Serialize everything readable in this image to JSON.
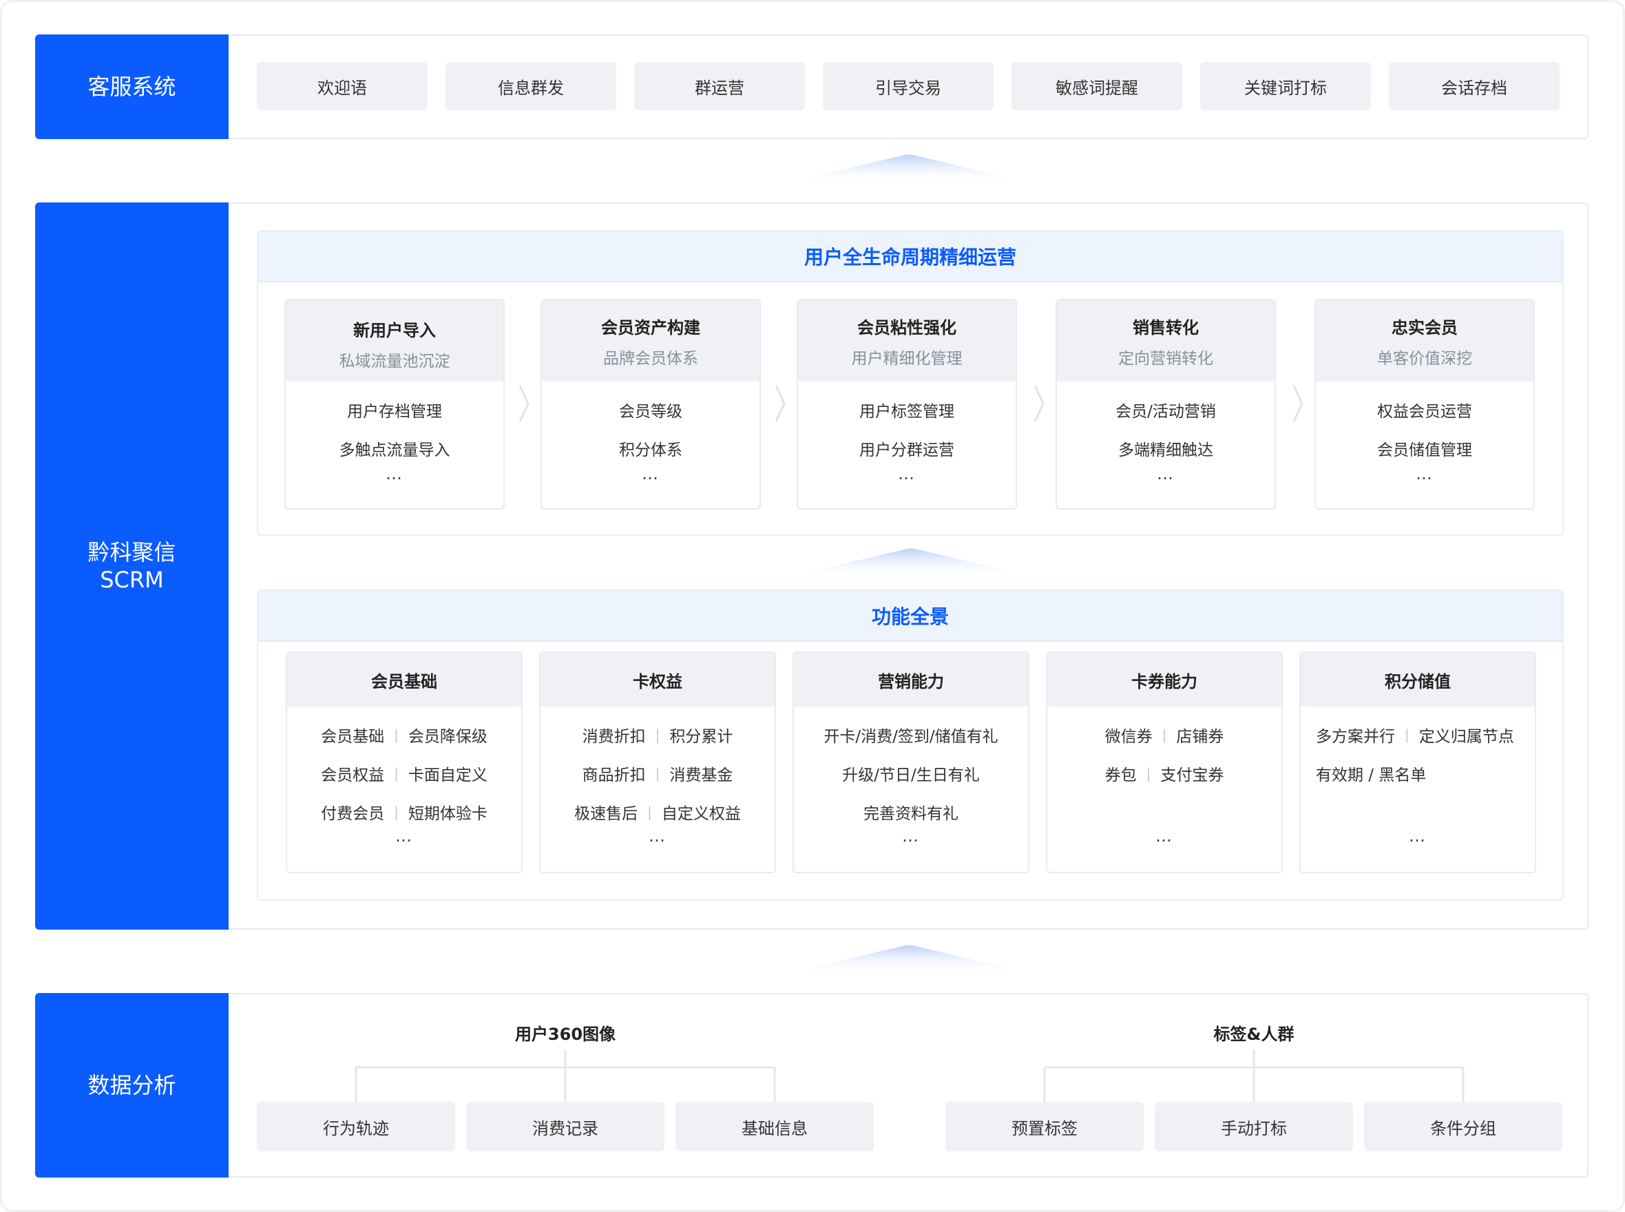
{
  "top": {
    "side_label": "客服系统",
    "chips": [
      "欢迎语",
      "信息群发",
      "群运营",
      "引导交易",
      "敏感词提醒",
      "关键词打标",
      "会话存档"
    ]
  },
  "middle": {
    "side_line1": "黔科聚信",
    "side_line2": "SCRM",
    "lifecycle": {
      "title": "用户全生命周期精细运营",
      "stages": [
        {
          "title": "新用户导入",
          "subtitle": "私域流量池沉淀",
          "items": [
            "用户存档管理",
            "多触点流量导入"
          ],
          "more": "…"
        },
        {
          "title": "会员资产构建",
          "subtitle": "品牌会员体系",
          "items": [
            "会员等级",
            "积分体系"
          ],
          "more": "…"
        },
        {
          "title": "会员粘性强化",
          "subtitle": "用户精细化管理",
          "items": [
            "用户标签管理",
            "用户分群运营"
          ],
          "more": "…"
        },
        {
          "title": "销售转化",
          "subtitle": "定向营销转化",
          "items": [
            "会员/活动营销",
            "多端精细触达"
          ],
          "more": "…"
        },
        {
          "title": "忠实会员",
          "subtitle": "单客价值深挖",
          "items": [
            "权益会员运营",
            "会员储值管理"
          ],
          "more": "…"
        }
      ]
    },
    "features": {
      "title": "功能全景",
      "cards": [
        {
          "title": "会员基础",
          "rows": [
            [
              "会员基础",
              "会员降保级"
            ],
            [
              "会员权益",
              "卡面自定义"
            ],
            [
              "付费会员",
              "短期体验卡"
            ]
          ],
          "more": "…"
        },
        {
          "title": "卡权益",
          "rows": [
            [
              "消费折扣",
              "积分累计"
            ],
            [
              "商品折扣",
              "消费基金"
            ],
            [
              "极速售后",
              "自定义权益"
            ]
          ],
          "more": "…"
        },
        {
          "title": "营销能力",
          "rows": [
            [
              "开卡/消费/签到/储值有礼"
            ],
            [
              "升级/节日/生日有礼"
            ],
            [
              "完善资料有礼"
            ]
          ],
          "more": "…"
        },
        {
          "title": "卡券能力",
          "rows": [
            [
              "微信券",
              "店铺券"
            ],
            [
              "券包",
              "支付宝券"
            ]
          ],
          "more": "…"
        },
        {
          "title": "积分储值",
          "rows": [
            [
              "多方案并行",
              "定义归属节点"
            ],
            [
              "有效期 / 黑名单"
            ]
          ],
          "more": "…"
        }
      ]
    }
  },
  "bottom": {
    "side_label": "数据分析",
    "groups": [
      {
        "title": "用户360图像",
        "leaves": [
          "行为轨迹",
          "消费记录",
          "基础信息"
        ]
      },
      {
        "title": "标签&人群",
        "leaves": [
          "预置标签",
          "手动打标",
          "条件分组"
        ]
      }
    ]
  },
  "colors": {
    "brand": "#0a5cff",
    "chip_bg": "#eff1f5",
    "panel_head_bg": "#eef4fd"
  }
}
